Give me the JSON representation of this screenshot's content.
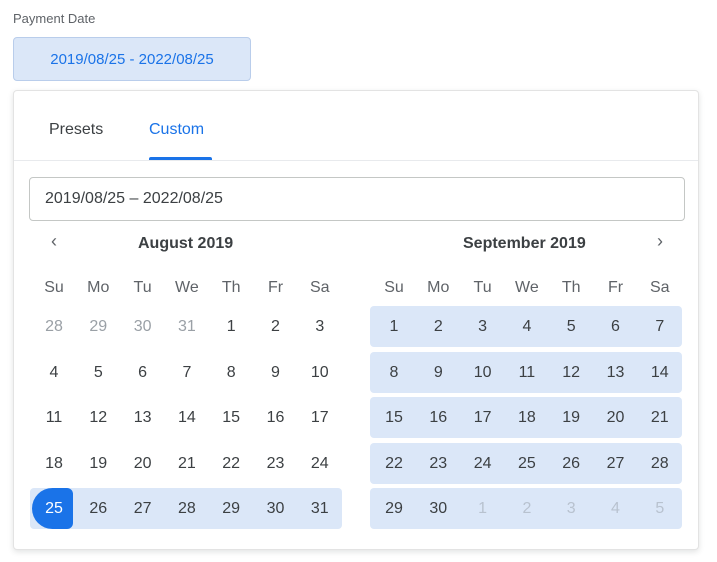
{
  "field_label": "Payment Date",
  "range_chip": "2019/08/25 - 2022/08/25",
  "tabs": [
    {
      "label": "Presets",
      "active": false
    },
    {
      "label": "Custom",
      "active": true
    }
  ],
  "range_input": "2019/08/25  –  2022/08/25",
  "nav": {
    "prev": "‹",
    "next": "›"
  },
  "weekdays": [
    "Su",
    "Mo",
    "Tu",
    "We",
    "Th",
    "Fr",
    "Sa"
  ],
  "colors": {
    "accent": "#1a73e8",
    "range_fill": "#dbe7f8"
  },
  "months": [
    {
      "title": "August 2019",
      "weeks": [
        [
          {
            "d": "28",
            "m": 1,
            "r": 0
          },
          {
            "d": "29",
            "m": 1,
            "r": 0
          },
          {
            "d": "30",
            "m": 1,
            "r": 0
          },
          {
            "d": "31",
            "m": 1,
            "r": 0
          },
          {
            "d": "1",
            "m": 0,
            "r": 0
          },
          {
            "d": "2",
            "m": 0,
            "r": 0
          },
          {
            "d": "3",
            "m": 0,
            "r": 0
          }
        ],
        [
          {
            "d": "4",
            "m": 0,
            "r": 0
          },
          {
            "d": "5",
            "m": 0,
            "r": 0
          },
          {
            "d": "6",
            "m": 0,
            "r": 0
          },
          {
            "d": "7",
            "m": 0,
            "r": 0
          },
          {
            "d": "8",
            "m": 0,
            "r": 0
          },
          {
            "d": "9",
            "m": 0,
            "r": 0
          },
          {
            "d": "10",
            "m": 0,
            "r": 0
          }
        ],
        [
          {
            "d": "11",
            "m": 0,
            "r": 0
          },
          {
            "d": "12",
            "m": 0,
            "r": 0
          },
          {
            "d": "13",
            "m": 0,
            "r": 0
          },
          {
            "d": "14",
            "m": 0,
            "r": 0
          },
          {
            "d": "15",
            "m": 0,
            "r": 0
          },
          {
            "d": "16",
            "m": 0,
            "r": 0
          },
          {
            "d": "17",
            "m": 0,
            "r": 0
          }
        ],
        [
          {
            "d": "18",
            "m": 0,
            "r": 0
          },
          {
            "d": "19",
            "m": 0,
            "r": 0
          },
          {
            "d": "20",
            "m": 0,
            "r": 0
          },
          {
            "d": "21",
            "m": 0,
            "r": 0
          },
          {
            "d": "22",
            "m": 0,
            "r": 0
          },
          {
            "d": "23",
            "m": 0,
            "r": 0
          },
          {
            "d": "24",
            "m": 0,
            "r": 0
          }
        ],
        [
          {
            "d": "25",
            "m": 0,
            "r": 1,
            "start": 1
          },
          {
            "d": "26",
            "m": 0,
            "r": 1
          },
          {
            "d": "27",
            "m": 0,
            "r": 1
          },
          {
            "d": "28",
            "m": 0,
            "r": 1
          },
          {
            "d": "29",
            "m": 0,
            "r": 1
          },
          {
            "d": "30",
            "m": 0,
            "r": 1
          },
          {
            "d": "31",
            "m": 0,
            "r": 1
          }
        ]
      ]
    },
    {
      "title": "September 2019",
      "weeks": [
        [
          {
            "d": "1",
            "m": 0,
            "r": 1
          },
          {
            "d": "2",
            "m": 0,
            "r": 1
          },
          {
            "d": "3",
            "m": 0,
            "r": 1
          },
          {
            "d": "4",
            "m": 0,
            "r": 1
          },
          {
            "d": "5",
            "m": 0,
            "r": 1
          },
          {
            "d": "6",
            "m": 0,
            "r": 1
          },
          {
            "d": "7",
            "m": 0,
            "r": 1
          }
        ],
        [
          {
            "d": "8",
            "m": 0,
            "r": 1
          },
          {
            "d": "9",
            "m": 0,
            "r": 1
          },
          {
            "d": "10",
            "m": 0,
            "r": 1
          },
          {
            "d": "11",
            "m": 0,
            "r": 1
          },
          {
            "d": "12",
            "m": 0,
            "r": 1
          },
          {
            "d": "13",
            "m": 0,
            "r": 1
          },
          {
            "d": "14",
            "m": 0,
            "r": 1
          }
        ],
        [
          {
            "d": "15",
            "m": 0,
            "r": 1
          },
          {
            "d": "16",
            "m": 0,
            "r": 1
          },
          {
            "d": "17",
            "m": 0,
            "r": 1
          },
          {
            "d": "18",
            "m": 0,
            "r": 1
          },
          {
            "d": "19",
            "m": 0,
            "r": 1
          },
          {
            "d": "20",
            "m": 0,
            "r": 1
          },
          {
            "d": "21",
            "m": 0,
            "r": 1
          }
        ],
        [
          {
            "d": "22",
            "m": 0,
            "r": 1
          },
          {
            "d": "23",
            "m": 0,
            "r": 1
          },
          {
            "d": "24",
            "m": 0,
            "r": 1
          },
          {
            "d": "25",
            "m": 0,
            "r": 1
          },
          {
            "d": "26",
            "m": 0,
            "r": 1
          },
          {
            "d": "27",
            "m": 0,
            "r": 1
          },
          {
            "d": "28",
            "m": 0,
            "r": 1
          }
        ],
        [
          {
            "d": "29",
            "m": 0,
            "r": 1
          },
          {
            "d": "30",
            "m": 0,
            "r": 1
          },
          {
            "d": "1",
            "m": 1,
            "r": 1
          },
          {
            "d": "2",
            "m": 1,
            "r": 1
          },
          {
            "d": "3",
            "m": 1,
            "r": 1
          },
          {
            "d": "4",
            "m": 1,
            "r": 1
          },
          {
            "d": "5",
            "m": 1,
            "r": 1
          }
        ]
      ]
    }
  ]
}
